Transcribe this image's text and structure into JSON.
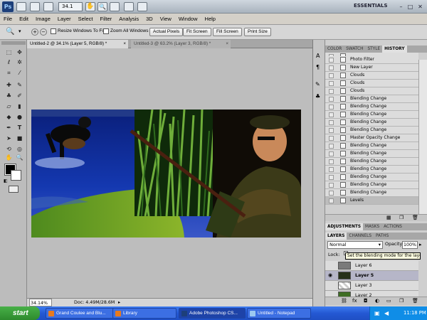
{
  "app": {
    "logo": "Ps",
    "zoom": "34.1",
    "workspace": "ESSENTIALS"
  },
  "menu": [
    "File",
    "Edit",
    "Image",
    "Layer",
    "Select",
    "Filter",
    "Analysis",
    "3D",
    "View",
    "Window",
    "Help"
  ],
  "options": {
    "resize_windows": "Resize Windows To Fit",
    "zoom_all": "Zoom All Windows",
    "actual_pixels": "Actual Pixels",
    "fit_screen": "Fit Screen",
    "fill_screen": "Fill Screen",
    "print_size": "Print Size"
  },
  "documents": {
    "active_tab": "Untitled-2 @ 34.1% (Layer 5, RGB/8) *",
    "inactive_tab": "Untitled-3 @ 63.2% (Layer 3, RGB/8) *"
  },
  "status": {
    "zoom": "34.14%",
    "doc": "Doc: 4.49M/28.6M"
  },
  "history_panel": {
    "tabs": [
      "COLOR",
      "SWATCH",
      "STYLE",
      "HISTORY"
    ],
    "items": [
      "Photo Filter",
      "New Layer",
      "Clouds",
      "Clouds",
      "Clouds",
      "Blending Change",
      "Blending Change",
      "Blending Change",
      "Blending Change",
      "Blending Change",
      "Master Opacity Change",
      "Blending Change",
      "Blending Change",
      "Blending Change",
      "Blending Change",
      "Blending Change",
      "Blending Change",
      "Blending Change",
      "Levels"
    ]
  },
  "adjust_panel": {
    "tabs": [
      "ADJUSTMENTS",
      "MASKS",
      "ACTIONS"
    ]
  },
  "layers_panel": {
    "tabs": [
      "LAYERS",
      "CHANNELS",
      "PATHS"
    ],
    "blend_mode": "Normal",
    "opacity_label": "Opacity:",
    "opacity": "100%",
    "lock_label": "Lock:",
    "tooltip": "Set the blending mode for the layer",
    "layers": [
      "Layer 6",
      "Layer 5",
      "Layer 3",
      "Layer 2"
    ]
  },
  "taskbar": {
    "start": "start",
    "items": [
      "Grand Coulee and Blu...",
      "Library",
      "Adobe Photoshop CS...",
      "Untitled - Notepad"
    ],
    "clock": "11:18 PM"
  }
}
